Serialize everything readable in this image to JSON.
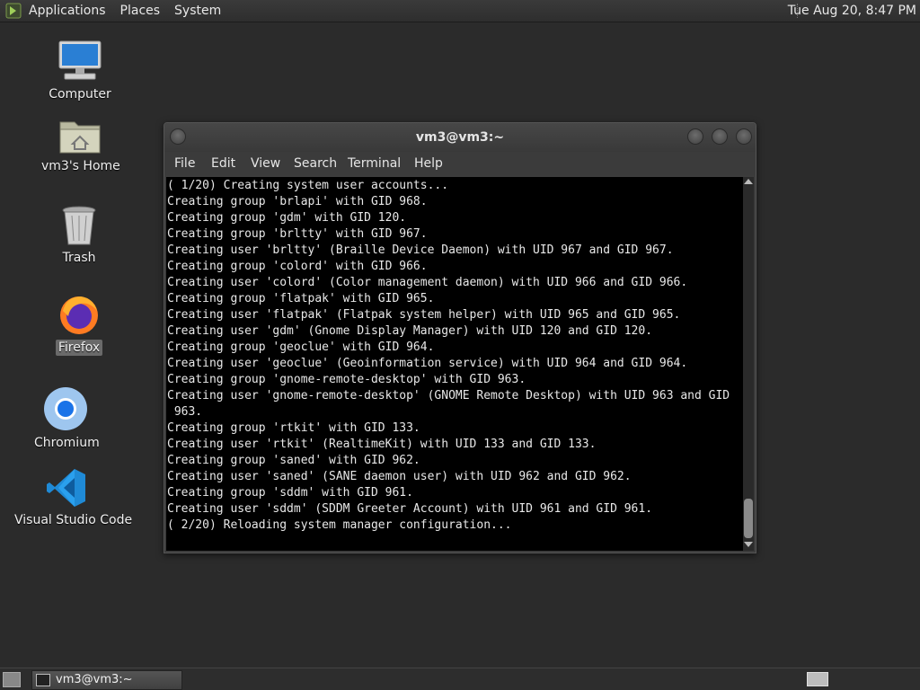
{
  "top_panel": {
    "menus": [
      "Applications",
      "Places",
      "System"
    ],
    "clock": "Tue Aug 20,  8:47 PM"
  },
  "desktop": {
    "icons": [
      {
        "label": "Computer",
        "icon": "computer-icon"
      },
      {
        "label": "vm3's Home",
        "icon": "home-folder-icon"
      },
      {
        "label": "Trash",
        "icon": "trash-icon"
      },
      {
        "label": "Firefox",
        "icon": "firefox-icon",
        "selected": true
      },
      {
        "label": "Chromium",
        "icon": "chromium-icon"
      },
      {
        "label": "Visual Studio Code",
        "icon": "vscode-icon"
      }
    ]
  },
  "terminal_window": {
    "title": "vm3@vm3:~",
    "menu": [
      "File",
      "Edit",
      "View",
      "Search",
      "Terminal",
      "Help"
    ],
    "lines": [
      "( 1/20) Creating system user accounts...",
      "Creating group 'brlapi' with GID 968.",
      "Creating group 'gdm' with GID 120.",
      "Creating group 'brltty' with GID 967.",
      "Creating user 'brltty' (Braille Device Daemon) with UID 967 and GID 967.",
      "Creating group 'colord' with GID 966.",
      "Creating user 'colord' (Color management daemon) with UID 966 and GID 966.",
      "Creating group 'flatpak' with GID 965.",
      "Creating user 'flatpak' (Flatpak system helper) with UID 965 and GID 965.",
      "Creating user 'gdm' (Gnome Display Manager) with UID 120 and GID 120.",
      "Creating group 'geoclue' with GID 964.",
      "Creating user 'geoclue' (Geoinformation service) with UID 964 and GID 964.",
      "Creating group 'gnome-remote-desktop' with GID 963.",
      "Creating user 'gnome-remote-desktop' (GNOME Remote Desktop) with UID 963 and GID",
      " 963.",
      "Creating group 'rtkit' with GID 133.",
      "Creating user 'rtkit' (RealtimeKit) with UID 133 and GID 133.",
      "Creating group 'saned' with GID 962.",
      "Creating user 'saned' (SANE daemon user) with UID 962 and GID 962.",
      "Creating group 'sddm' with GID 961.",
      "Creating user 'sddm' (SDDM Greeter Account) with UID 961 and GID 961.",
      "( 2/20) Reloading system manager configuration..."
    ]
  },
  "taskbar": {
    "tasks": [
      {
        "label": "vm3@vm3:~",
        "icon": "terminal-icon"
      }
    ]
  }
}
